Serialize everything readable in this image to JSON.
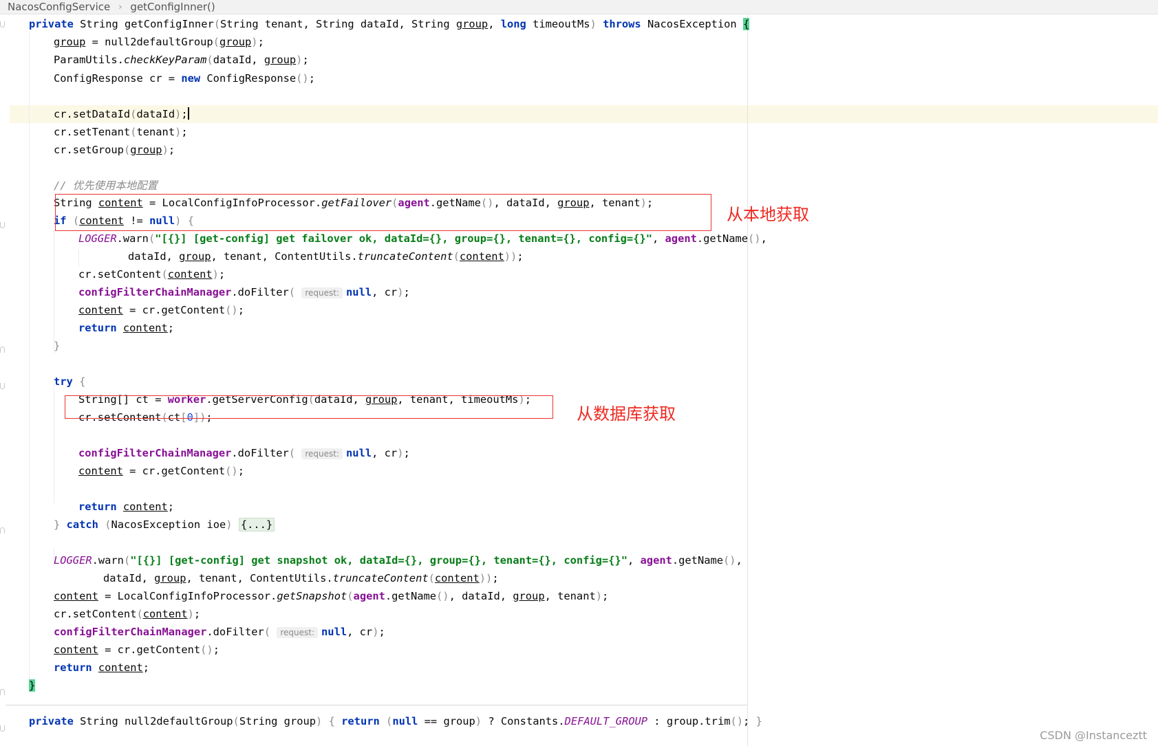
{
  "breadcrumb": {
    "class_name": "NacosConfigService",
    "method_name": "getConfigInner()"
  },
  "annotations": {
    "local": "从本地获取",
    "database": "从数据库获取"
  },
  "watermark": "CSDN @Instanceztt",
  "inlay_hint": "request:",
  "comment": "// 优先使用本地配置",
  "colors": {
    "keyword": "#0033b3",
    "field": "#871094",
    "string": "#067d17",
    "annotation_red": "#ee2a22",
    "current_line": "#fcf8e6",
    "brace_match": "#55d493"
  }
}
